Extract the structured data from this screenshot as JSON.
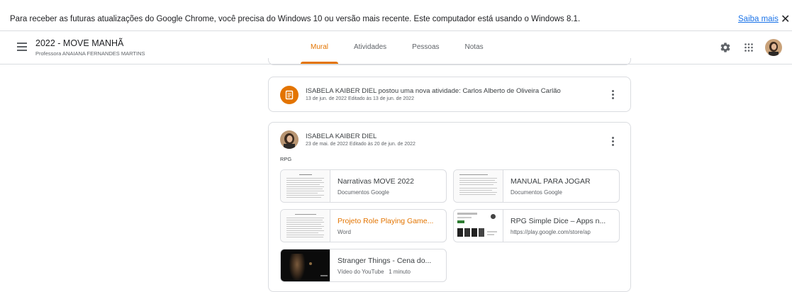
{
  "infobar": {
    "message": "Para receber as futuras atualizações do Google Chrome, você precisa do Windows 10 ou versão mais recente. Este computador está usando o Windows 8.1.",
    "learn_more": "Saiba mais",
    "close": "✕"
  },
  "header": {
    "class_title": "2022 - MOVE MANHÃ",
    "teacher": "Professora ANAIANA FERNANDES MARTINS",
    "tabs": [
      {
        "label": "Mural",
        "active": true
      },
      {
        "label": "Atividades",
        "active": false
      },
      {
        "label": "Pessoas",
        "active": false
      },
      {
        "label": "Notas",
        "active": false
      }
    ],
    "accent_color": "#e37400"
  },
  "stream": {
    "activity_post": {
      "title": "ISABELA KAIBER DIEL postou uma nova atividade: Carlos Alberto de Oliveira Carlão",
      "date": "13 de jun. de 2022 Editado às 13 de jun. de 2022"
    },
    "material_post": {
      "author": "ISABELA KAIBER DIEL",
      "date": "23 de mai. de 2022 Editado às 20 de jun. de 2022",
      "text": "RPG",
      "attachments": [
        {
          "title": "Narrativas MOVE 2022",
          "subtitle": "Documentos Google"
        },
        {
          "title": "MANUAL PARA JOGAR",
          "subtitle": "Documentos Google"
        },
        {
          "title": "Projeto Role Playing Game...",
          "subtitle": "Word"
        },
        {
          "title": "RPG Simple Dice – Apps n...",
          "subtitle": "https://play.google.com/store/ap"
        },
        {
          "title": "Stranger Things - Cena do...",
          "subtitle": "Vídeo do YouTube   1 minuto"
        }
      ]
    }
  }
}
